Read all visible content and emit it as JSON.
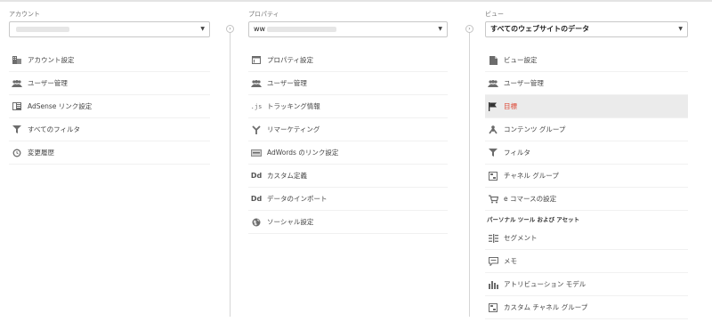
{
  "account": {
    "label": "アカウント",
    "items": [
      {
        "label": "アカウント設定",
        "icon": "building-icon"
      },
      {
        "label": "ユーザー管理",
        "icon": "users-icon"
      },
      {
        "label": "AdSense リンク設定",
        "icon": "adsense-icon"
      },
      {
        "label": "すべてのフィルタ",
        "icon": "filter-icon"
      },
      {
        "label": "変更履歴",
        "icon": "history-icon"
      }
    ]
  },
  "property": {
    "label": "プロパティ",
    "select_value": "ww",
    "items": [
      {
        "label": "プロパティ設定",
        "icon": "property-icon"
      },
      {
        "label": "ユーザー管理",
        "icon": "users-icon"
      },
      {
        "label": "トラッキング情報",
        "icon": "js-icon"
      },
      {
        "label": "リマーケティング",
        "icon": "remarketing-icon"
      },
      {
        "label": "AdWords のリンク設定",
        "icon": "adwords-icon"
      },
      {
        "label": "カスタム定義",
        "icon": "dd-icon"
      },
      {
        "label": "データのインポート",
        "icon": "dd-icon"
      },
      {
        "label": "ソーシャル設定",
        "icon": "globe-icon"
      }
    ]
  },
  "view": {
    "label": "ビュー",
    "select_value": "すべてのウェブサイトのデータ",
    "items": [
      {
        "label": "ビュー設定",
        "icon": "document-icon"
      },
      {
        "label": "ユーザー管理",
        "icon": "users-icon"
      },
      {
        "label": "目標",
        "icon": "flag-icon",
        "active": true
      },
      {
        "label": "コンテンツ グループ",
        "icon": "content-group-icon"
      },
      {
        "label": "フィルタ",
        "icon": "filter-icon"
      },
      {
        "label": "チャネル グループ",
        "icon": "channel-icon"
      },
      {
        "label": "e コマースの設定",
        "icon": "cart-icon"
      }
    ],
    "section_title": "パーソナル ツール および アセット",
    "personal_items": [
      {
        "label": "セグメント",
        "icon": "segment-icon"
      },
      {
        "label": "メモ",
        "icon": "memo-icon"
      },
      {
        "label": "アトリビューション モデル",
        "icon": "bar-chart-icon"
      },
      {
        "label": "カスタム チャネル グループ",
        "icon": "channel-icon"
      }
    ]
  },
  "colors": {
    "active_text": "#dd4b39",
    "active_bg": "#ebebeb",
    "icon": "#6c6c6c"
  }
}
